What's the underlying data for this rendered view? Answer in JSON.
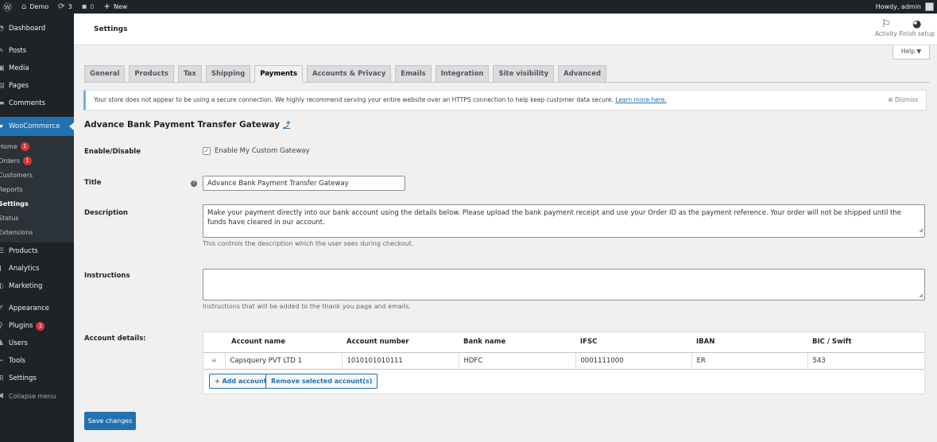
{
  "adminbar": {
    "site_name": "Demo",
    "updates_count": "3",
    "comments_count": "0",
    "new_label": "New",
    "howdy": "Howdy, admin"
  },
  "sidebar": {
    "items_top": [
      {
        "label": "Dashboard",
        "icon": "dashboard-icon"
      },
      {
        "label": "Posts",
        "icon": "pin-icon"
      },
      {
        "label": "Media",
        "icon": "media-icon"
      },
      {
        "label": "Pages",
        "icon": "pages-icon"
      },
      {
        "label": "Comments",
        "icon": "comments-icon"
      }
    ],
    "woocommerce": {
      "label": "WooCommerce"
    },
    "woo_sub": [
      {
        "label": "Home",
        "badge": "1"
      },
      {
        "label": "Orders",
        "badge": "1"
      },
      {
        "label": "Customers"
      },
      {
        "label": "Reports"
      },
      {
        "label": "Settings"
      },
      {
        "label": "Status"
      },
      {
        "label": "Extensions"
      }
    ],
    "items_mid": [
      {
        "label": "Products"
      },
      {
        "label": "Analytics"
      },
      {
        "label": "Marketing"
      }
    ],
    "items_bottom": [
      {
        "label": "Appearance"
      },
      {
        "label": "Plugins",
        "badge": "1"
      },
      {
        "label": "Users"
      },
      {
        "label": "Tools"
      },
      {
        "label": "Settings"
      }
    ],
    "collapse_label": "Collapse menu"
  },
  "header": {
    "title": "Settings",
    "activity_label": "Activity",
    "finish_setup_label": "Finish setup",
    "help_label": "Help ▼"
  },
  "tabs": [
    {
      "label": "General"
    },
    {
      "label": "Products"
    },
    {
      "label": "Tax"
    },
    {
      "label": "Shipping"
    },
    {
      "label": "Payments",
      "active": true
    },
    {
      "label": "Accounts & Privacy"
    },
    {
      "label": "Emails"
    },
    {
      "label": "Integration"
    },
    {
      "label": "Site visibility"
    },
    {
      "label": "Advanced"
    }
  ],
  "notice": {
    "text": "Your store does not appear to be using a secure connection. We highly recommend serving your entire website over an HTTPS connection to help keep customer data secure. ",
    "link": "Learn more here.",
    "dismiss": "Dismiss"
  },
  "gateway": {
    "heading": "Advance Bank Payment Transfer Gateway",
    "up_link": "⤴",
    "enable_label": "Enable/Disable",
    "enable_checkbox_label": "Enable My Custom Gateway",
    "enable_checked": true,
    "title_label": "Title",
    "title_value": "Advance Bank Payment Transfer Gateway",
    "description_label": "Description",
    "description_value": "Make your payment directly into our bank account using the details below. Please upload the bank payment receipt and use your Order ID as the payment reference. Your order will not be shipped until the funds have cleared in our account.",
    "description_help": "This controls the description which the user sees during checkout.",
    "instructions_label": "Instructions",
    "instructions_value": "",
    "instructions_help": "Instructions that will be added to the thank you page and emails.",
    "account_details_label": "Account details:"
  },
  "accounts": {
    "columns": [
      "Account name",
      "Account number",
      "Bank name",
      "IFSC",
      "IBAN",
      "BIC / Swift"
    ],
    "rows": [
      [
        "Capsquery PVT LTD 1",
        "1010101010111",
        "HDFC",
        "0001111000",
        "ER",
        "543"
      ]
    ],
    "add_label": "+ Add account",
    "remove_label": "Remove selected account(s)"
  },
  "save_label": "Save changes"
}
